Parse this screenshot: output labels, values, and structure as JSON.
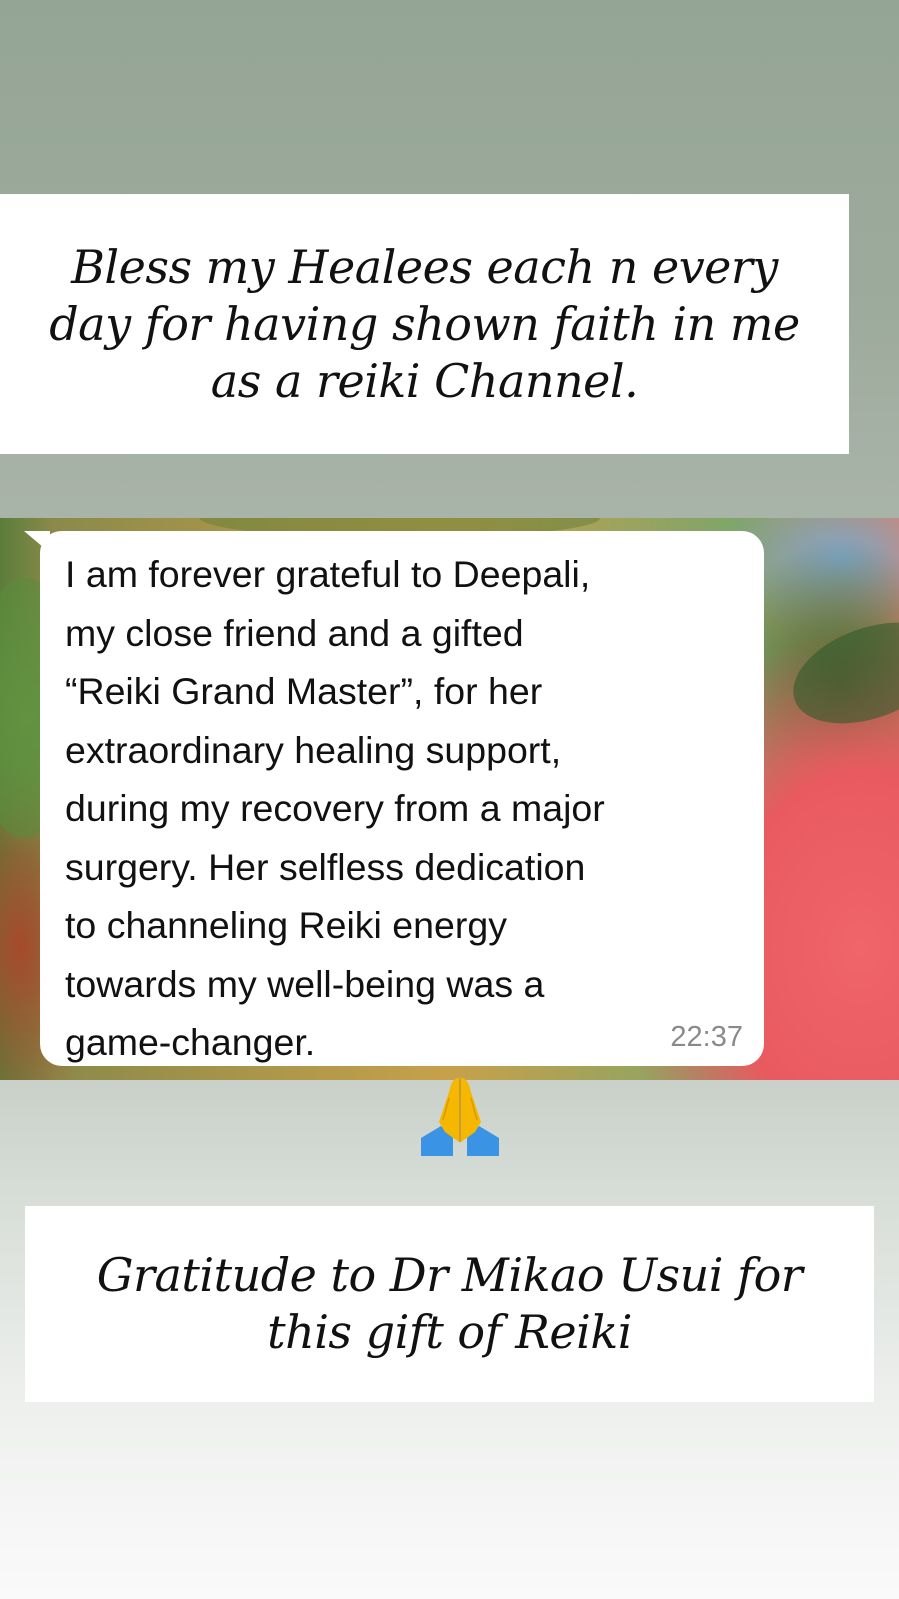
{
  "top_quote": {
    "text": "Bless my Healees each n every day for having shown faith in me as a reiki Channel."
  },
  "message": {
    "text": "I am forever grateful to Deepali,\nmy close friend and a gifted\n“Reiki Grand Master”, for her\nextraordinary healing support,\nduring my recovery from a major\nsurgery. Her selfless dedication\nto channeling Reiki energy\ntowards my well-being was a\ngame-changer.",
    "time": "22:37"
  },
  "emoji": {
    "icon": "folded-hands-icon",
    "colors": {
      "hands": "#f5b700",
      "sleeves": "#3b93e6"
    }
  },
  "bottom_quote": {
    "text": "Gratitude to Dr Mikao Usui for this gift of Reiki"
  }
}
